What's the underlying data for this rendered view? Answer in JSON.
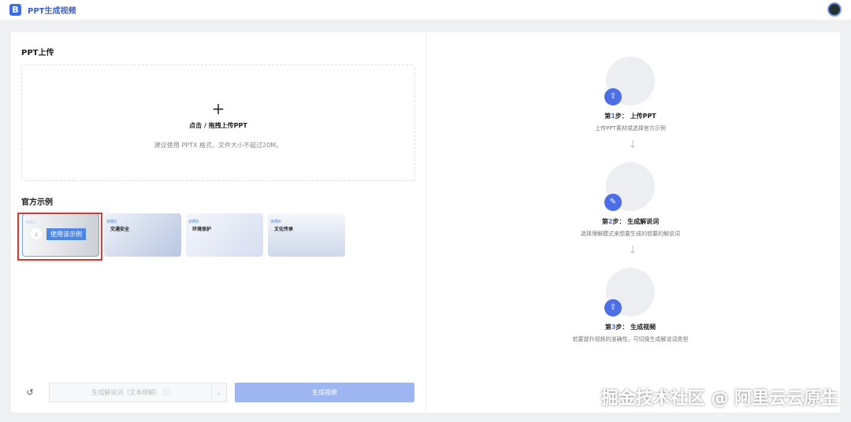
{
  "header": {
    "logo": "B",
    "title": "PPT生成视频"
  },
  "upload": {
    "title": "PPT上传",
    "plus": "+",
    "drop_title": "点击 / 拖拽上传PPT",
    "drop_hint": "建议使用 PPTX 格式，文件大小不超过20M。"
  },
  "examples": {
    "title": "官方示例",
    "use_label": "使用该示例",
    "items": [
      {
        "tag": "示例1",
        "name": ""
      },
      {
        "tag": "示例2",
        "name": "交通安全"
      },
      {
        "tag": "示例3",
        "name": "环境保护"
      },
      {
        "tag": "示例4",
        "name": "文化传承"
      }
    ]
  },
  "controls": {
    "mode_label": "生成解说词（文本理解） ⓘ",
    "generate_label": "生成视频"
  },
  "steps": [
    {
      "prefix": "第",
      "num": "1",
      "suffix": "步： 上传PPT",
      "desc": "上传PPT素材或选择官方示例"
    },
    {
      "prefix": "第",
      "num": "2",
      "suffix": "步： 生成解说词",
      "desc": "选择理解模式来想要生成的想要的解说词"
    },
    {
      "prefix": "第",
      "num": "3",
      "suffix": "步： 生成视频",
      "desc": "若要提升视频的准确性，可切换生成解说词类型"
    }
  ],
  "watermark": "掘金技术社区 @ 阿里云云原生"
}
